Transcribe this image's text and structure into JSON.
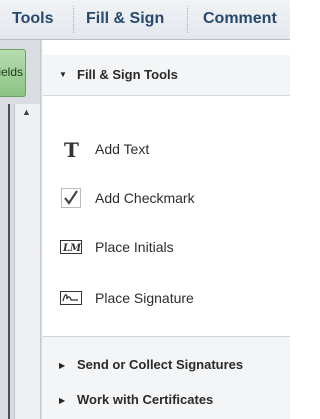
{
  "tabs": {
    "tools": "Tools",
    "fill_sign": "Fill & Sign",
    "comment": "Comment"
  },
  "left_panel": {
    "fields_button": "Fields"
  },
  "fill_sign_tools": {
    "header": "Fill & Sign Tools",
    "items": [
      {
        "label": "Add Text",
        "icon": "text-t-icon"
      },
      {
        "label": "Add Checkmark",
        "icon": "checkmark-icon"
      },
      {
        "label": "Place Initials",
        "icon": "initials-icon"
      },
      {
        "label": "Place Signature",
        "icon": "signature-icon"
      }
    ]
  },
  "collapsed_sections": [
    {
      "label": "Send or Collect Signatures"
    },
    {
      "label": "Work with Certificates"
    }
  ],
  "colors": {
    "tab_text": "#27496d",
    "fields_button": "#9fcf97",
    "panel_header_bg": "#f4f5f7"
  }
}
